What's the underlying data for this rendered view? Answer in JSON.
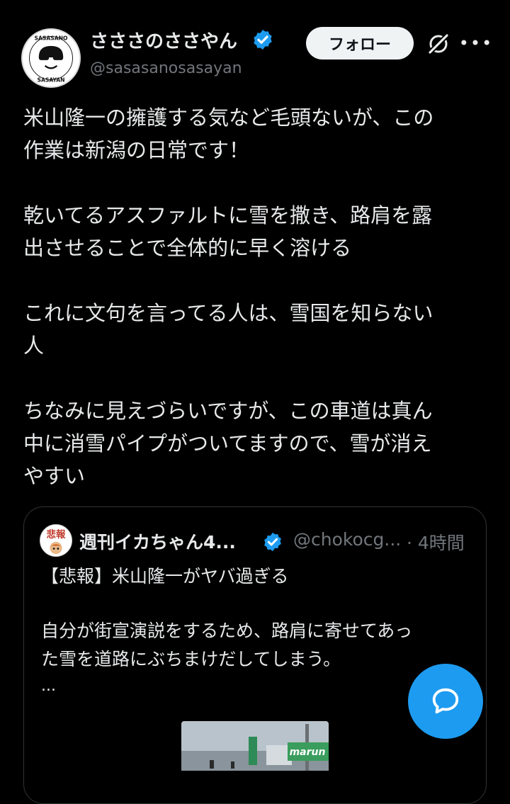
{
  "author": {
    "display_name": "さささのささやん",
    "handle": "@sasasanosasayan",
    "follow_label": "フォロー",
    "avatar_text_top": "SASASANO",
    "avatar_text_bottom": "SASAYAN",
    "verified_icon": "verified-badge-icon"
  },
  "tweet": {
    "paragraphs": [
      [
        "米山隆一の擁護する気など毛頭ないが、この",
        "作業は新潟の日常です！"
      ],
      [
        "乾いてるアスファルトに雪を撒き、路肩を露",
        "出させることで全体的に早く溶ける"
      ],
      [
        "これに文句を言ってる人は、雪国を知らない",
        "人"
      ],
      [
        "ちなみに見えづらいですが、この車道は真ん",
        "中に消雪パイプがついてますので、雪が消え",
        "やすい"
      ]
    ]
  },
  "quoted": {
    "display_name": "週刊イカちゃん4...",
    "handle": "@chokocg...",
    "time": "· 4時間",
    "avatar_text": "悲報",
    "title": "【悲報】米山隆一がヤバ過ぎる",
    "body_lines": [
      "自分が街宣演説をするため、路肩に寄せてあっ",
      "た雪を道路にぶちまけだしてしまう。"
    ],
    "ellipsis": "...",
    "media_sign_text": "marun"
  },
  "colors": {
    "background": "#000000",
    "text": "#e7e9ea",
    "secondary": "#71767b",
    "accent": "#1d9bf0",
    "border": "#2f3336"
  },
  "icons": {
    "grok": "grok-icon",
    "more": "more-icon",
    "compose": "chat-bubble-icon"
  }
}
